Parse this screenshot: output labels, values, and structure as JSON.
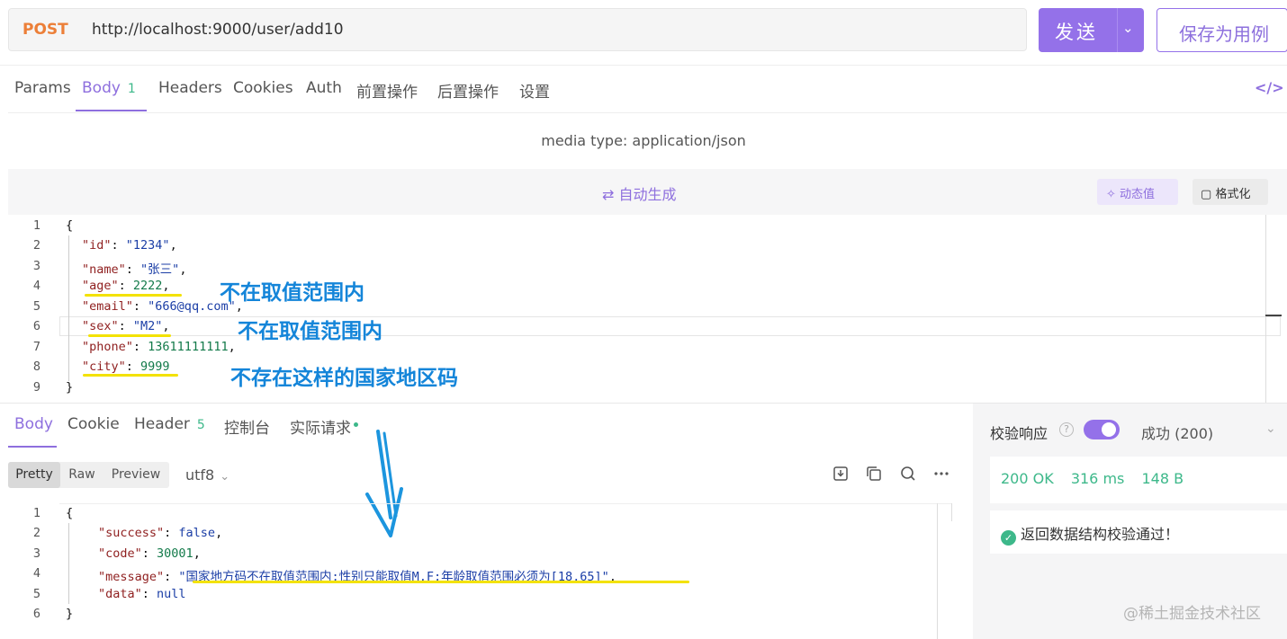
{
  "request": {
    "method": "POST",
    "url": "http://localhost:9000/user/add10",
    "send_label": "发送",
    "save_label": "保存为用例"
  },
  "request_tabs": [
    {
      "label": "Params"
    },
    {
      "label": "Body",
      "badge": "1"
    },
    {
      "label": "Headers"
    },
    {
      "label": "Cookies"
    },
    {
      "label": "Auth"
    },
    {
      "label": "前置操作"
    },
    {
      "label": "后置操作"
    },
    {
      "label": "设置"
    }
  ],
  "code_toggle": "</>",
  "media_type": "media type: application/json",
  "editor": {
    "autogen_label": "自动生成",
    "dynamic_label": "动态值",
    "format_label": "格式化"
  },
  "request_body_lines": [
    "{",
    "\"id\": \"1234\",",
    "\"name\": \"张三\",",
    "\"age\": 2222,",
    "\"email\": \"666@qq.com\",",
    "\"sex\": \"M2\",",
    "\"phone\": 13611111111,",
    "\"city\": 9999",
    "}"
  ],
  "request_body": {
    "id_key": "\"id\"",
    "id_val": "\"1234\"",
    "name_key": "\"name\"",
    "name_val": "\"张三\"",
    "age_key": "\"age\"",
    "age_val": "2222",
    "email_key": "\"email\"",
    "email_val": "\"666@qq.com\"",
    "sex_key": "\"sex\"",
    "sex_val": "\"M2\"",
    "phone_key": "\"phone\"",
    "phone_val": "13611111111",
    "city_key": "\"city\"",
    "city_val": "9999"
  },
  "annotations": {
    "age": "不在取值范围内",
    "sex": "不在取值范围内",
    "city": "不存在这样的国家地区码"
  },
  "response_tabs": [
    {
      "label": "Body"
    },
    {
      "label": "Cookie"
    },
    {
      "label": "Header",
      "badge": "5"
    },
    {
      "label": "控制台"
    },
    {
      "label": "实际请求"
    }
  ],
  "view_modes": [
    "Pretty",
    "Raw",
    "Preview"
  ],
  "encoding": "utf8",
  "response_body": {
    "success_key": "\"success\"",
    "success_val": "false",
    "code_key": "\"code\"",
    "code_val": "30001",
    "message_key": "\"message\"",
    "message_val": "\"国家地方码不在取值范围内;性别只能取值M,F;年龄取值范围必须为[18,65]\"",
    "data_key": "\"data\"",
    "data_val": "null"
  },
  "validation": {
    "title": "校验响应",
    "status": "成功 (200)",
    "http_status": "200 OK",
    "time": "316 ms",
    "size": "148 B",
    "message": "返回数据结构校验通过！"
  },
  "watermark": "@稀土掘金技术社区",
  "colors": {
    "accent": "#9471e9",
    "method": "#ec7f38",
    "success": "#3db88a",
    "annotation": "#1485d9",
    "highlight": "#f3e200"
  }
}
